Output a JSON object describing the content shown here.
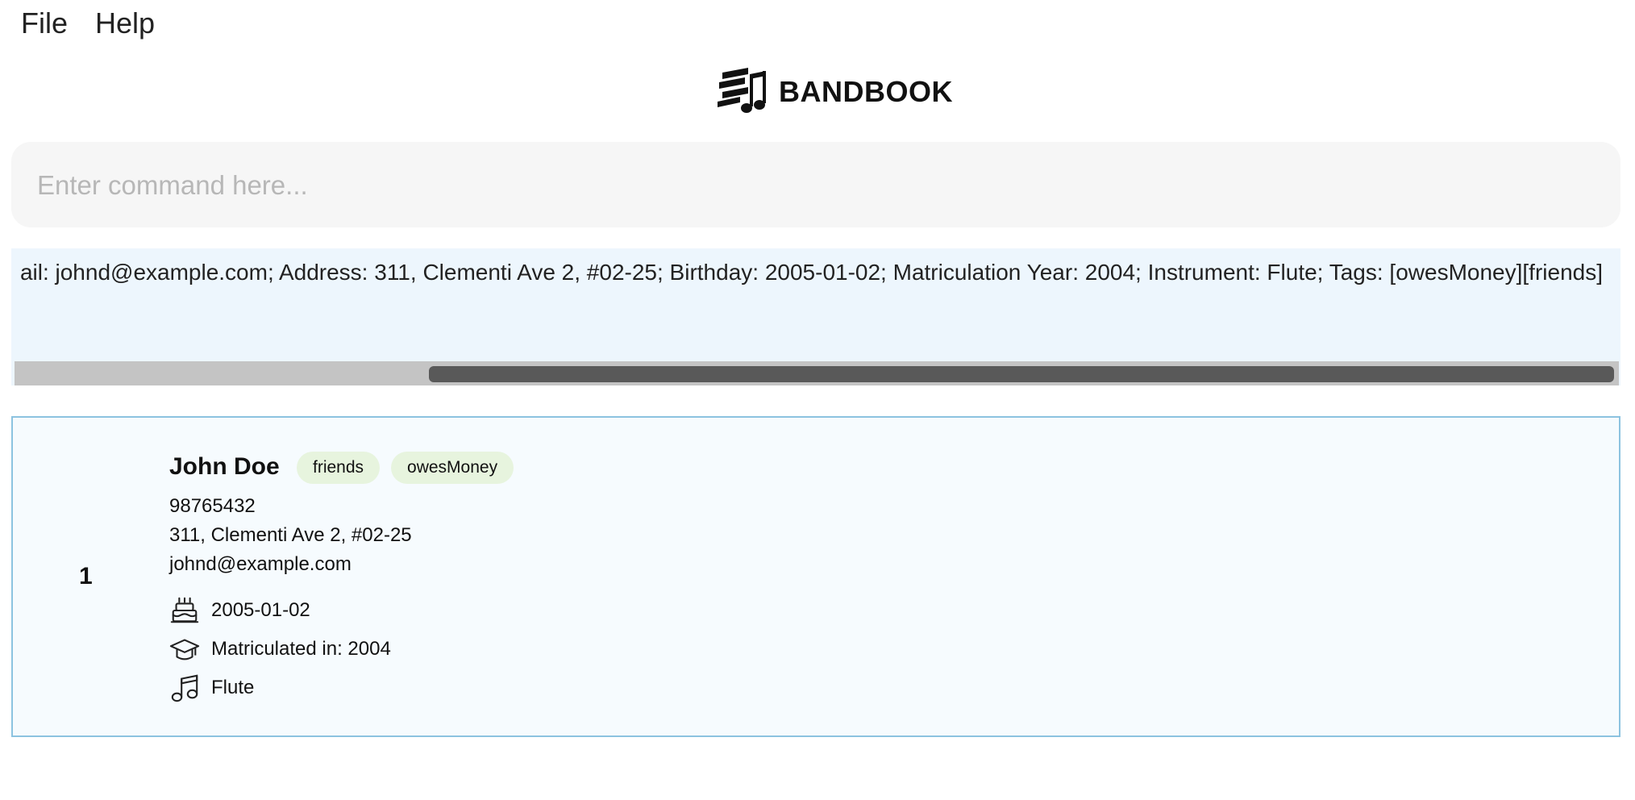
{
  "menu": {
    "file": "File",
    "help": "Help"
  },
  "app": {
    "name": "BANDBOOK",
    "logo_icon": "music-book-logo"
  },
  "command": {
    "placeholder": "Enter command here...",
    "value": ""
  },
  "result": {
    "text": "ail: johnd@example.com; Address: 311, Clementi Ave 2, #02-25; Birthday: 2005-01-02; Matriculation Year: 2004; Instrument: Flute; Tags: [owesMoney][friends]",
    "scroll_position": 0.74
  },
  "persons": [
    {
      "index": "1",
      "name": "John Doe",
      "tags": [
        "friends",
        "owesMoney"
      ],
      "phone": "98765432",
      "address": "311, Clementi Ave 2, #02-25",
      "email": "johnd@example.com",
      "birthday": "2005-01-02",
      "matriculation": "Matriculated in: 2004",
      "instrument": "Flute",
      "icons": {
        "birthday": "cake-icon",
        "matriculation": "graduation-cap-icon",
        "instrument": "music-note-icon"
      }
    }
  ],
  "colors": {
    "result_bg": "#edf6fd",
    "card_border": "#8cc3e0",
    "tag_bg": "#e7f4de",
    "command_bg": "#f6f6f6"
  }
}
